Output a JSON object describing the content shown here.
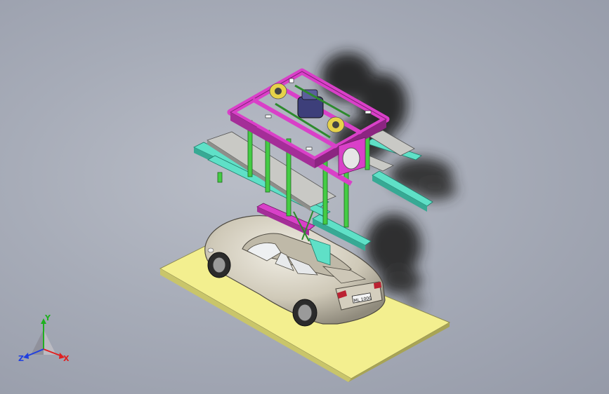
{
  "viewport": {
    "background": "#a9aeb9",
    "view": "isometric"
  },
  "model": {
    "floor_color": "#f3ef8f",
    "car_color": "#d8d3c4",
    "frame_colors": {
      "magenta": "#d940c8",
      "green": "#44cc44",
      "cyan": "#5fe0c7",
      "panel": "#c9c9c5",
      "shadow": "#1a1a1a"
    },
    "license_plate": "ML 1000"
  },
  "triad": {
    "x_label": "X",
    "y_label": "Y",
    "z_label": "Z",
    "x_color": "#e02020",
    "y_color": "#20b020",
    "z_color": "#2040e0"
  }
}
